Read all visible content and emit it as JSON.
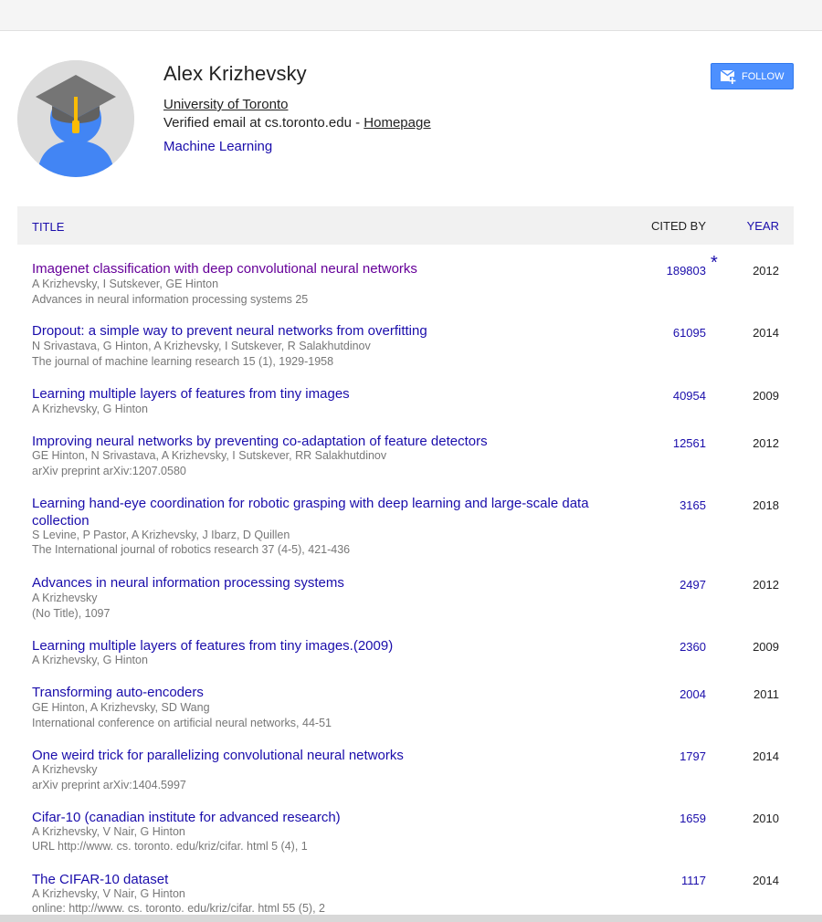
{
  "profile": {
    "name": "Alex Krizhevsky",
    "affiliation": "University of Toronto",
    "email_text": "Verified email at cs.toronto.edu - ",
    "homepage_label": "Homepage",
    "interest": "Machine Learning",
    "follow_label": "FOLLOW"
  },
  "table": {
    "headers": {
      "title": "TITLE",
      "cited_by": "CITED BY",
      "year": "YEAR"
    },
    "rows": [
      {
        "title": "Imagenet classification with deep convolutional neural networks",
        "authors": "A Krizhevsky, I Sutskever, GE Hinton",
        "venue": "Advances in neural information processing systems 25",
        "cited": "189803",
        "year": "2012",
        "star": "*"
      },
      {
        "title": "Dropout: a simple way to prevent neural networks from overfitting",
        "authors": "N Srivastava, G Hinton, A Krizhevsky, I Sutskever, R Salakhutdinov",
        "venue": "The journal of machine learning research 15 (1), 1929-1958",
        "cited": "61095",
        "year": "2014"
      },
      {
        "title": "Learning multiple layers of features from tiny images",
        "authors": "A Krizhevsky, G Hinton",
        "venue": "",
        "cited": "40954",
        "year": "2009"
      },
      {
        "title": "Improving neural networks by preventing co-adaptation of feature detectors",
        "authors": "GE Hinton, N Srivastava, A Krizhevsky, I Sutskever, RR Salakhutdinov",
        "venue": "arXiv preprint arXiv:1207.0580",
        "cited": "12561",
        "year": "2012"
      },
      {
        "title": "Learning hand-eye coordination for robotic grasping with deep learning and large-scale data collection",
        "authors": "S Levine, P Pastor, A Krizhevsky, J Ibarz, D Quillen",
        "venue": "The International journal of robotics research 37 (4-5), 421-436",
        "cited": "3165",
        "year": "2018"
      },
      {
        "title": "Advances in neural information processing systems",
        "authors": "A Krizhevsky",
        "venue": "(No Title), 1097",
        "cited": "2497",
        "year": "2012"
      },
      {
        "title": "Learning multiple layers of features from tiny images.(2009)",
        "authors": "A Krizhevsky, G Hinton",
        "venue": "",
        "cited": "2360",
        "year": "2009"
      },
      {
        "title": "Transforming auto-encoders",
        "authors": "GE Hinton, A Krizhevsky, SD Wang",
        "venue": "International conference on artificial neural networks, 44-51",
        "cited": "2004",
        "year": "2011"
      },
      {
        "title": "One weird trick for parallelizing convolutional neural networks",
        "authors": "A Krizhevsky",
        "venue": "arXiv preprint arXiv:1404.5997",
        "cited": "1797",
        "year": "2014"
      },
      {
        "title": "Cifar-10 (canadian institute for advanced research)",
        "authors": "A Krizhevsky, V Nair, G Hinton",
        "venue": "URL http://www. cs. toronto. edu/kriz/cifar. html 5 (4), 1",
        "cited": "1659",
        "year": "2010"
      },
      {
        "title": "The CIFAR-10 dataset",
        "authors": "A Krizhevsky, V Nair, G Hinton",
        "venue": "online: http://www. cs. toronto. edu/kriz/cifar. html 55 (5), 2",
        "cited": "1117",
        "year": "2014"
      }
    ]
  }
}
